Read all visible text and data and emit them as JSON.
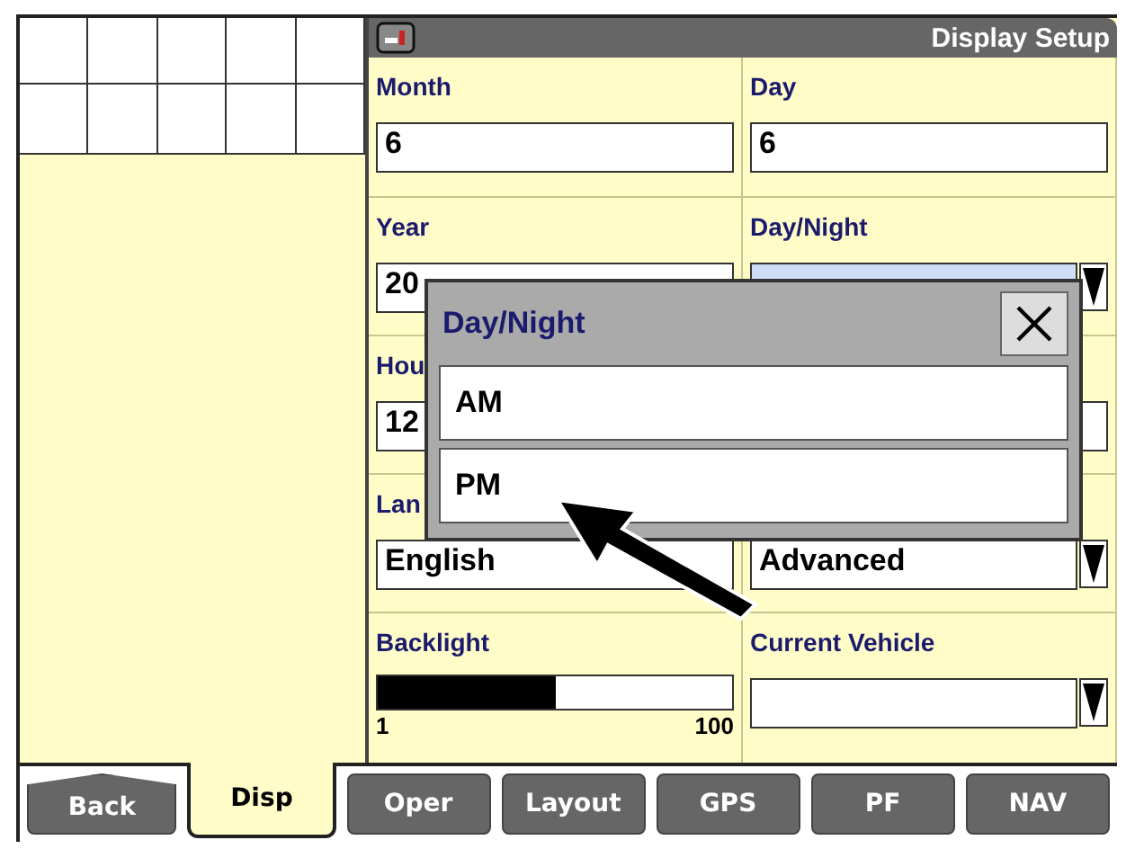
{
  "window": {
    "title": "Display Setup"
  },
  "fields": [
    {
      "kind": "text",
      "label": "Month",
      "value": "6",
      "selected": false
    },
    {
      "kind": "text",
      "label": "Day",
      "value": "6",
      "selected": false
    },
    {
      "kind": "text",
      "label": "Year",
      "value": "20",
      "selected": false
    },
    {
      "kind": "dropdown",
      "label": "Day/Night",
      "selected": true
    },
    {
      "kind": "text",
      "label": "Hou",
      "value": "12",
      "selected": false
    },
    {
      "kind": "text",
      "selected": false
    },
    {
      "kind": "text",
      "label": "Lan",
      "value": "English",
      "selected": false
    },
    {
      "kind": "dropdown",
      "value": "Advanced",
      "selected": false
    },
    {
      "kind": "slider",
      "label": "Backlight",
      "level": 0.5,
      "min": "1",
      "max": "100"
    },
    {
      "kind": "dropdown",
      "label": "Current Vehicle",
      "selected": false
    }
  ],
  "popup": {
    "title": "Day/Night",
    "options": [
      {
        "label": "AM"
      },
      {
        "label": "PM"
      }
    ]
  },
  "tabs": [
    {
      "kind": "back",
      "label": "Back",
      "selected": false
    },
    {
      "kind": "tab",
      "label": "Disp",
      "selected": true
    },
    {
      "kind": "tab",
      "label": "Oper",
      "selected": false
    },
    {
      "kind": "tab",
      "label": "Layout",
      "selected": false
    },
    {
      "kind": "tab",
      "label": "GPS",
      "selected": false
    },
    {
      "kind": "tab",
      "label": "PF",
      "selected": false
    },
    {
      "kind": "tab",
      "label": "NAV",
      "selected": false
    }
  ]
}
